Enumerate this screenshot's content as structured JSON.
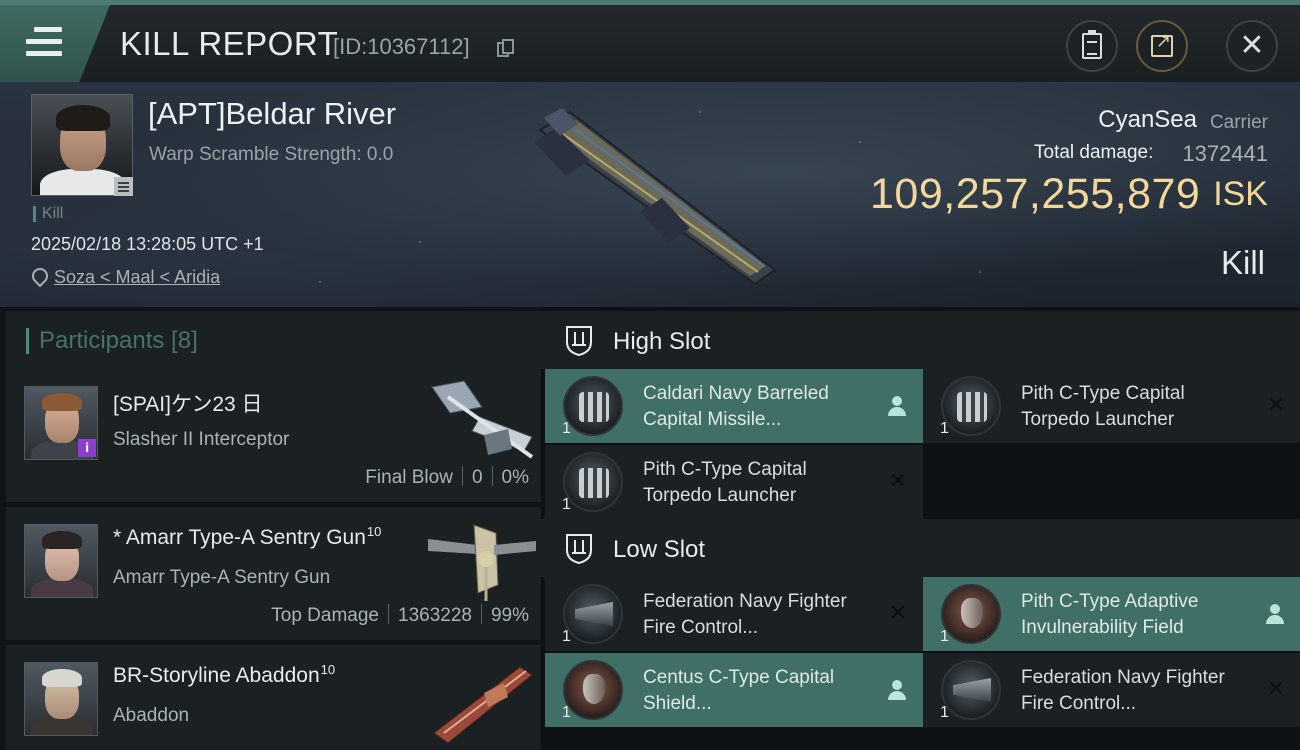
{
  "header": {
    "title": "KILL REPORT",
    "kill_id": "[ID:10367112]",
    "menu_icon": "hamburger-menu-icon",
    "clipboard_icon": "clipboard-icon",
    "share_icon": "share-icon",
    "close_icon": "close-icon"
  },
  "victim": {
    "name": "[APT]Beldar River",
    "warp_scramble": "Warp Scramble Strength: 0.0",
    "kill_tag": "Kill",
    "datetime": "2025/02/18 13:28:05 UTC +1",
    "location": "Soza < Maal < Aridia",
    "corp": "CyanSea",
    "ship_type": "Carrier",
    "total_damage_label": "Total damage:",
    "total_damage_value": "1372441",
    "isk_value": "109,257,255,879",
    "isk_unit": "ISK",
    "result": "Kill"
  },
  "participants": {
    "header": "Participants [8]",
    "rows": [
      {
        "name": "[SPAI]ケン23 日",
        "level": "",
        "ship": "Slasher II Interceptor",
        "role": "Final Blow",
        "damage": "0",
        "percent": "0%",
        "badge": "i"
      },
      {
        "name": "* Amarr Type-A Sentry Gun",
        "level": "10",
        "ship": "Amarr Type-A Sentry Gun",
        "role": "Top Damage",
        "damage": "1363228",
        "percent": "99%"
      },
      {
        "name": "BR-Storyline Abaddon",
        "level": "10",
        "ship": "Abaddon"
      }
    ]
  },
  "fittings": {
    "high_slot_label": "High Slot",
    "low_slot_label": "Low Slot",
    "high": [
      {
        "qty": "1",
        "name": "Caldari Navy Barreled Capital Missile...",
        "status": "dropped"
      },
      {
        "qty": "1",
        "name": "Pith C-Type Capital Torpedo Launcher",
        "status": "destroyed"
      },
      {
        "qty": "1",
        "name": "Pith C-Type Capital Torpedo Launcher",
        "status": "destroyed"
      }
    ],
    "low": [
      {
        "qty": "1",
        "name": "Federation Navy Fighter Fire Control...",
        "status": "destroyed"
      },
      {
        "qty": "1",
        "name": "Pith C-Type Adaptive Invulnerability Field",
        "status": "dropped"
      },
      {
        "qty": "1",
        "name": "Centus C-Type Capital Shield...",
        "status": "dropped"
      },
      {
        "qty": "1",
        "name": "Federation Navy Fighter Fire Control...",
        "status": "destroyed"
      }
    ]
  },
  "colors": {
    "accent": "#4f8a7e",
    "dropped_bg": "#3f6f66",
    "isk_gold": "#f2d79a"
  }
}
